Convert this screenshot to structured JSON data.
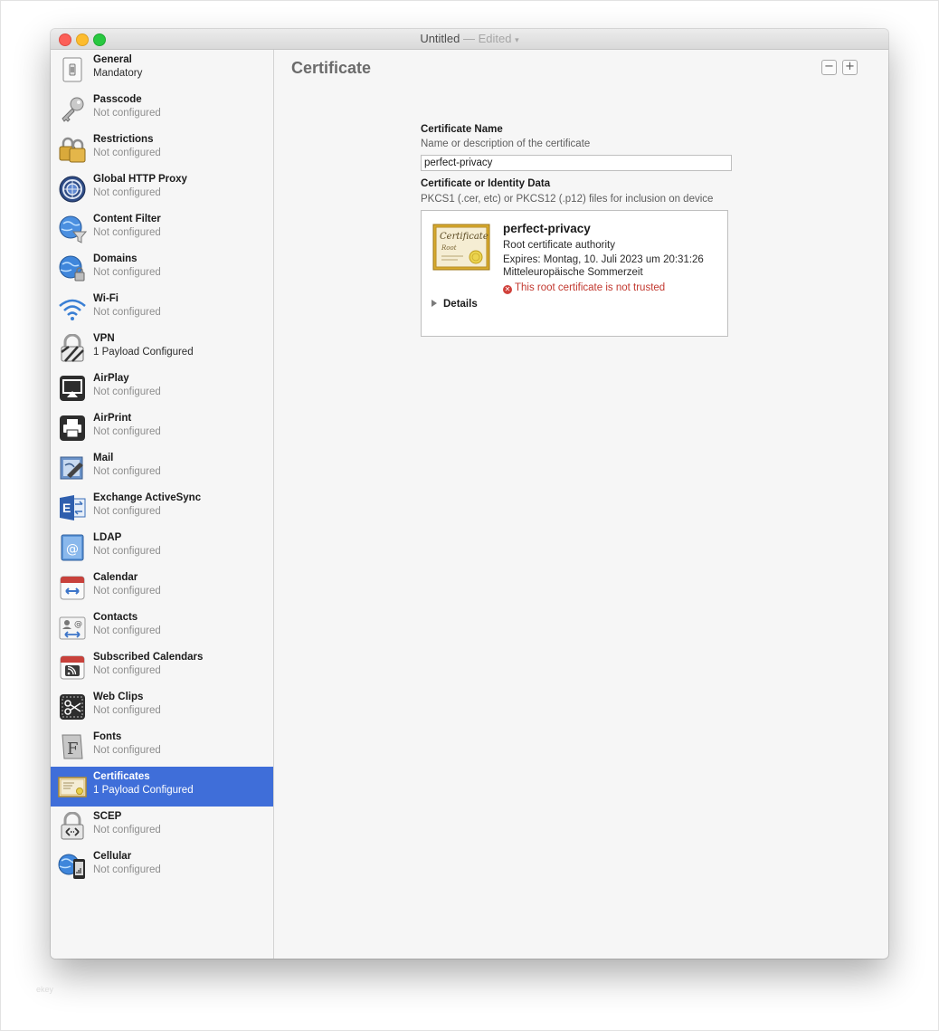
{
  "window": {
    "title": "Untitled",
    "title_separator": "—",
    "edited_label": "Edited"
  },
  "sidebar": {
    "items": [
      {
        "name": "General",
        "status": "Mandatory",
        "icon": "general-icon"
      },
      {
        "name": "Passcode",
        "status": "Not configured",
        "icon": "key-icon"
      },
      {
        "name": "Restrictions",
        "status": "Not configured",
        "icon": "padlocks-icon"
      },
      {
        "name": "Global HTTP Proxy",
        "status": "Not configured",
        "icon": "proxy-globe-icon"
      },
      {
        "name": "Content Filter",
        "status": "Not configured",
        "icon": "filter-globe-icon"
      },
      {
        "name": "Domains",
        "status": "Not configured",
        "icon": "domains-globe-icon"
      },
      {
        "name": "Wi-Fi",
        "status": "Not configured",
        "icon": "wifi-icon"
      },
      {
        "name": "VPN",
        "status": "1 Payload Configured",
        "icon": "vpn-lock-icon"
      },
      {
        "name": "AirPlay",
        "status": "Not configured",
        "icon": "airplay-icon"
      },
      {
        "name": "AirPrint",
        "status": "Not configured",
        "icon": "printer-icon"
      },
      {
        "name": "Mail",
        "status": "Not configured",
        "icon": "mail-icon"
      },
      {
        "name": "Exchange ActiveSync",
        "status": "Not configured",
        "icon": "exchange-icon"
      },
      {
        "name": "LDAP",
        "status": "Not configured",
        "icon": "ldap-at-icon"
      },
      {
        "name": "Calendar",
        "status": "Not configured",
        "icon": "calendar-icon"
      },
      {
        "name": "Contacts",
        "status": "Not configured",
        "icon": "contacts-icon"
      },
      {
        "name": "Subscribed Calendars",
        "status": "Not configured",
        "icon": "subscribed-calendar-icon"
      },
      {
        "name": "Web Clips",
        "status": "Not configured",
        "icon": "scissors-icon"
      },
      {
        "name": "Fonts",
        "status": "Not configured",
        "icon": "font-icon"
      },
      {
        "name": "Certificates",
        "status": "1 Payload Configured",
        "icon": "certificate-icon",
        "selected": true
      },
      {
        "name": "SCEP",
        "status": "Not configured",
        "icon": "scep-lock-icon"
      },
      {
        "name": "Cellular",
        "status": "Not configured",
        "icon": "cellular-icon"
      }
    ]
  },
  "main": {
    "title": "Certificate",
    "minus_label": "−",
    "plus_label": "+",
    "cert_name_label": "Certificate Name",
    "cert_name_help": "Name or description of the certificate",
    "cert_name_value": "perfect-privacy",
    "cert_data_label": "Certificate or Identity Data",
    "cert_data_help": "PKCS1 (.cer, etc) or PKCS12 (.p12) files for inclusion on device",
    "certificate": {
      "name": "perfect-privacy",
      "type": "Root certificate authority",
      "expires": "Expires: Montag, 10. Juli 2023 um 20:31:26",
      "timezone": "Mitteleuropäische Sommerzeit",
      "warning": "This root certificate is not trusted",
      "details_label": "Details",
      "image_script_text": "Certificate",
      "image_sub_text": "Root"
    }
  },
  "colors": {
    "selection": "#3f6ed9",
    "warning": "#c2382f"
  },
  "watermark": "ekey"
}
